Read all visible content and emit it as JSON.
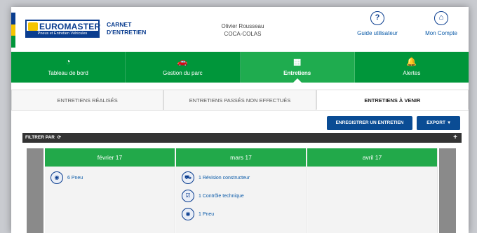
{
  "brand": {
    "name": "EUROMASTER",
    "tagline": "Pneus et Entretien Véhicules",
    "product_line1": "CARNET",
    "product_line2": "D'ENTRETIEN"
  },
  "user": {
    "name": "Olivier Rousseau",
    "company": "COCA-COLAS"
  },
  "header_actions": [
    {
      "label": "Guide utilisateur",
      "icon": "question-icon",
      "glyph": "?"
    },
    {
      "label": "Mon Compte",
      "icon": "account-icon",
      "glyph": "⌂"
    }
  ],
  "nav": [
    {
      "label": "Tableau de bord",
      "icon": "dashboard-icon",
      "glyph": "◔"
    },
    {
      "label": "Gestion du parc",
      "icon": "car-icon",
      "glyph": "🚗"
    },
    {
      "label": "Entretiens",
      "icon": "calendar-icon",
      "glyph": "▦",
      "active": true
    },
    {
      "label": "Alertes",
      "icon": "bell-icon",
      "glyph": "🔔"
    }
  ],
  "tabs": [
    {
      "label": "ENTRETIENS RÉALISÉS"
    },
    {
      "label": "ENTRETIENS PASSÉS NON EFFECTUÉS"
    },
    {
      "label": "ENTRETIENS À VENIR",
      "active": true
    }
  ],
  "actions": {
    "register": "ENREGISTRER UN ENTRETIEN",
    "export": "EXPORT"
  },
  "filter": {
    "label": "FILTRER PAR"
  },
  "calendar": {
    "months": [
      {
        "label": "février 17",
        "events": [
          {
            "text": "6 Pneu",
            "icon": "tire-icon"
          }
        ]
      },
      {
        "label": "mars 17",
        "events": [
          {
            "text": "1 Révision constructeur",
            "icon": "car-service-icon"
          },
          {
            "text": "1 Contrôle technique",
            "icon": "inspection-icon"
          },
          {
            "text": "1 Pneu",
            "icon": "tire-icon"
          }
        ]
      },
      {
        "label": "avril 17",
        "events": []
      }
    ]
  },
  "colors": {
    "brand_blue": "#0a3d8f",
    "nav_green": "#00963a",
    "active_green": "#1fac4f",
    "button_blue": "#0a4c94"
  }
}
